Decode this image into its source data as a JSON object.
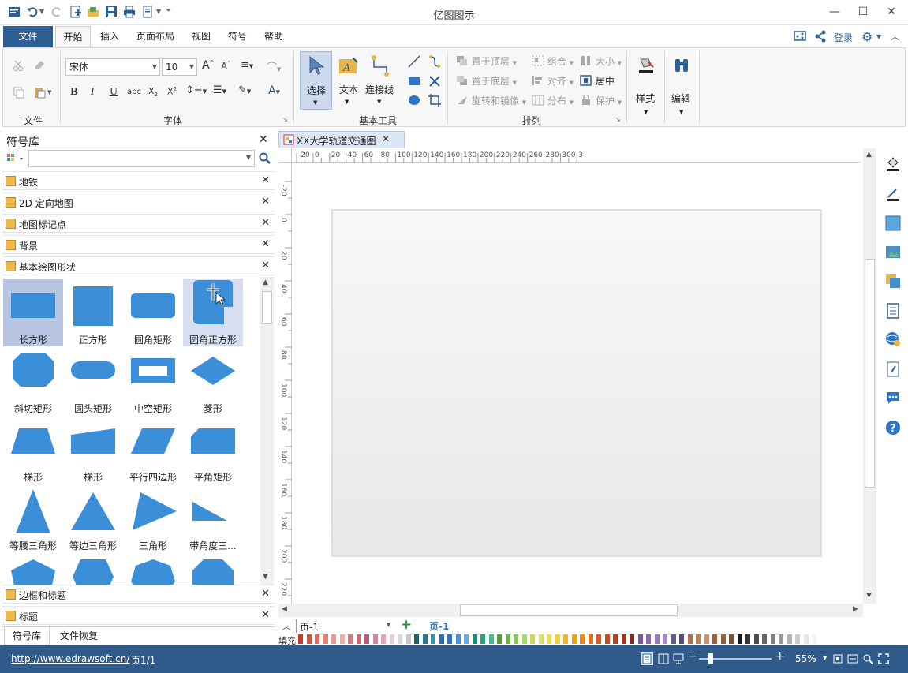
{
  "app": {
    "title": "亿图图示"
  },
  "menu": {
    "file": "文件",
    "home": "开始",
    "insert": "插入",
    "layout": "页面布局",
    "view": "视图",
    "symbol": "符号",
    "help": "帮助",
    "login": "登录"
  },
  "ribbon": {
    "file_group": "文件",
    "font_group": "字体",
    "font_name": "宋体",
    "font_size": "10",
    "basic_tools_group": "基本工具",
    "select": "选择",
    "text": "文本",
    "connector": "连接线",
    "arrange_group": "排列",
    "bring_front": "置于顶层",
    "send_back": "置于底层",
    "rotate": "旋转和镜像",
    "group": "组合",
    "align": "对齐",
    "distribute": "分布",
    "size": "大小",
    "center": "居中",
    "protect": "保护",
    "style": "样式",
    "edit": "编辑"
  },
  "library": {
    "title": "符号库",
    "categories": [
      "地铁",
      "2D 定向地图",
      "地图标记点",
      "背景",
      "基本绘图形状"
    ],
    "shapes": [
      {
        "name": "长方形"
      },
      {
        "name": "正方形"
      },
      {
        "name": "圆角矩形"
      },
      {
        "name": "圆角正方形"
      },
      {
        "name": "斜切矩形"
      },
      {
        "name": "圆头矩形"
      },
      {
        "name": "中空矩形"
      },
      {
        "name": "菱形"
      },
      {
        "name": "梯形"
      },
      {
        "name": "梯形"
      },
      {
        "name": "平行四边形"
      },
      {
        "name": "平角矩形"
      },
      {
        "name": "等腰三角形"
      },
      {
        "name": "等边三角形"
      },
      {
        "name": "三角形"
      },
      {
        "name": "带角度三..."
      }
    ],
    "bottom_categories": [
      "边框和标题",
      "标题"
    ],
    "tab_library": "符号库",
    "tab_recovery": "文件恢复"
  },
  "document": {
    "tab": "XX大学轨道交通图"
  },
  "ruler": {
    "h": [
      "-20",
      "0",
      "20",
      "40",
      "60",
      "80",
      "100",
      "120",
      "140",
      "160",
      "180",
      "200",
      "220",
      "240",
      "260",
      "280",
      "300",
      "3"
    ],
    "v": [
      "-20",
      "0",
      "20",
      "40",
      "60",
      "80",
      "100",
      "120",
      "140",
      "160",
      "180",
      "200",
      "220"
    ]
  },
  "pages": {
    "selector": "页-1",
    "current": "页-1",
    "fill_label": "填充"
  },
  "status": {
    "url": "http://www.edrawsoft.cn/",
    "page": "页1/1",
    "zoom": "55%"
  },
  "colors": {
    "accent": "#2e5f94",
    "shape": "#3a8fd8"
  }
}
